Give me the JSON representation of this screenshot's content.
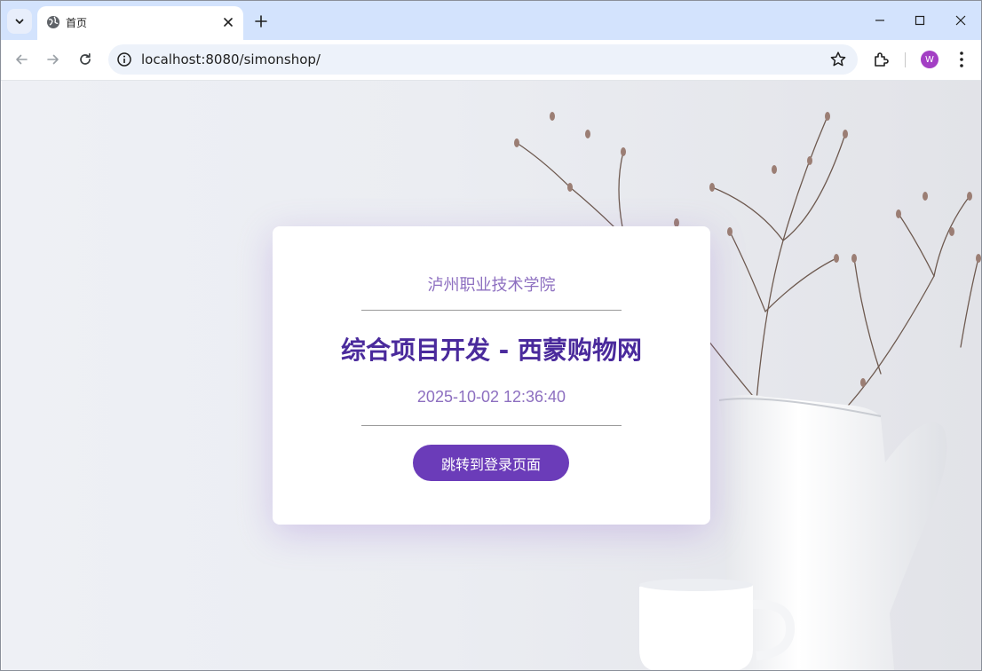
{
  "browser": {
    "tab": {
      "title": "首页",
      "favicon": "globe-icon"
    },
    "address_bar": {
      "url": "localhost:8080/simonshop/"
    },
    "profile_initial": "W",
    "colors": {
      "tabstrip": "#d3e3fd",
      "omnibox": "#edf2fa",
      "avatar": "#a33fc4"
    }
  },
  "page": {
    "school_name": "泸州职业技术学院",
    "course_title": "综合项目开发 - 西蒙购物网",
    "datetime": "2025-10-02 12:36:40",
    "login_button_label": "跳转到登录页面",
    "colors": {
      "title": "#4a2a9c",
      "subtitle": "#8d6fc0",
      "button": "#6b3cb9"
    }
  }
}
